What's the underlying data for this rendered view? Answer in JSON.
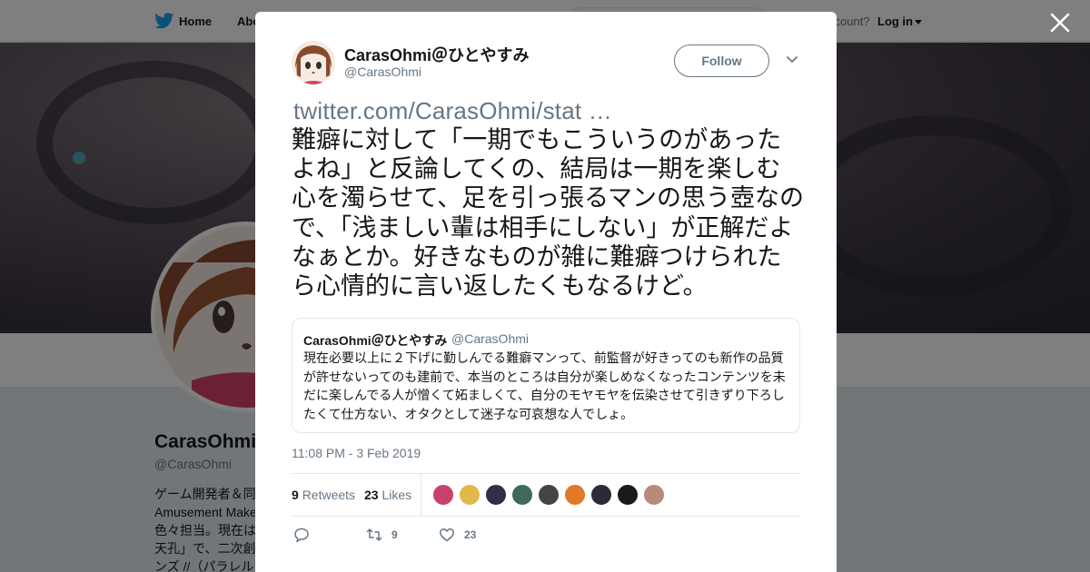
{
  "nav": {
    "home_label": "Home",
    "about_label": "Abo",
    "have_account": "ccount?",
    "login_label": "Log in"
  },
  "profile": {
    "name": "CarasOhmi",
    "handle": "@CarasOhmi",
    "bio_lines": [
      "ゲーム開発者＆同",
      "Amusement Make",
      "色々担当。現在は",
      "天孔」で、二次創",
      "ンズ //（パラレル"
    ]
  },
  "tweet": {
    "author_name": "CarasOhmi＠ひとやすみ",
    "author_handle": "@CarasOhmi",
    "follow_label": "Follow",
    "link_text": "twitter.com/CarasOhmi/stat …",
    "text": "難癖に対して「一期でもこういうのがあったよね」と反論してくの、結局は一期を楽しむ心を濁らせて、足を引っ張るマンの思う壺なので、「浅ましい輩は相手にしない」が正解だよなぁとか。好きなものが雑に難癖つけられたら心情的に言い返したくもなるけど。",
    "timestamp": "11:08 PM - 3 Feb 2019",
    "retweets_count": "9",
    "retweets_label": "Retweets",
    "likes_count": "23",
    "likes_label": "Likes",
    "action_retweet_count": "9",
    "action_like_count": "23",
    "liker_faces": [
      "#c7426a",
      "#e2b84a",
      "#2f2f4a",
      "#3e6a5a",
      "#444",
      "#e07a2a",
      "#2a2a3a",
      "#1a1a1a",
      "#b88a7a"
    ]
  },
  "quote": {
    "author_name": "CarasOhmi＠ひとやすみ",
    "author_handle": "@CarasOhmi",
    "text": "現在必要以上に２下げに勤しんでる難癖マンって、前監督が好きってのも新作の品質が許せないってのも建前で、本当のところは自分が楽しめなくなったコンテンツを未だに楽しんでる人が憎くて妬ましくて、自分のモヤモヤを伝染させて引きずり下ろしたくて仕方ない、オタクとして迷子な可哀想な人でしょ。"
  },
  "colors": {
    "brand": "#1da1f2",
    "text": "#14171a",
    "muted": "#657786",
    "border": "#e1e8ed"
  },
  "icons": [
    "twitter-bird-icon",
    "caret-down-icon",
    "close-icon",
    "chevron-down-icon",
    "reply-icon",
    "retweet-icon",
    "like-icon"
  ]
}
